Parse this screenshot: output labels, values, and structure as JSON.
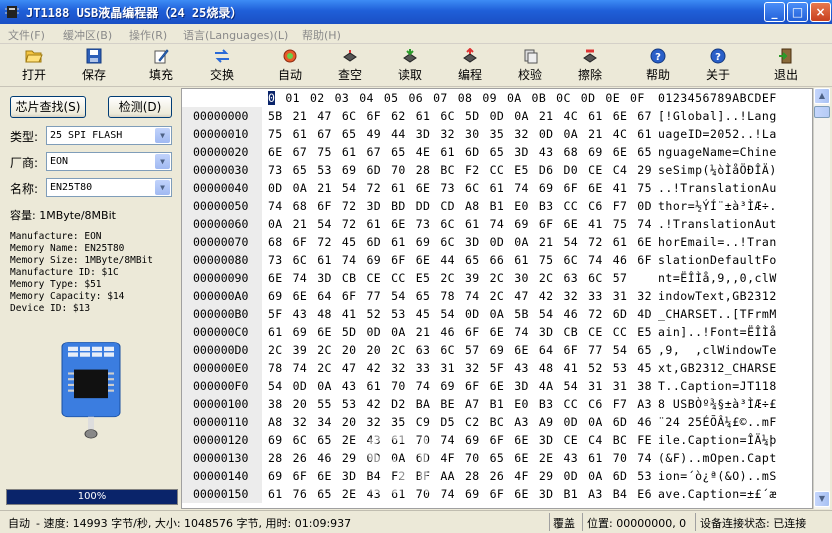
{
  "window": {
    "title": "JT1188 USB液晶编程器（24 25烧录）",
    "minimize": "_",
    "maximize": "□",
    "close": "×"
  },
  "menu": [
    "文件(F)",
    "缓冲区(B)",
    "操作(R)",
    "语言(Languages)(L)",
    "帮助(H)"
  ],
  "toolbar": {
    "open": "打开",
    "save": "保存",
    "fill": "填充",
    "swap": "交换",
    "auto": "自动",
    "check_empty": "查空",
    "read": "读取",
    "program": "编程",
    "verify": "校验",
    "erase": "擦除",
    "help": "帮助",
    "about": "关于",
    "exit": "退出"
  },
  "left": {
    "find_chip": "芯片查找(S)",
    "detect": "检测(D)",
    "type_label": "类型:",
    "type_value": "25 SPI FLASH",
    "vendor_label": "厂商:",
    "vendor_value": "EON",
    "name_label": "名称:",
    "name_value": "EN25T80",
    "capacity": "容量: 1MByte/8MBit",
    "info": [
      "Manufacture: EON",
      "Memory Name: EN25T80",
      "Memory Size: 1MByte/8MBit",
      "Manufacture ID: $1C",
      "Memory Type: $51",
      "Memory Capacity: $14",
      "Device ID: $13"
    ],
    "progress_label": "100%",
    "progress": 1.0
  },
  "hex": {
    "header_cols": "0 01 02 03 04 05 06 07 08 09 0A 0B 0C 0D 0E 0F",
    "header_ascii": "0123456789ABCDEF",
    "rows": [
      {
        "addr": "00000000",
        "bytes": "5B 21 47 6C 6F 62 61 6C 5D 0D 0A 21 4C 61 6E 67",
        "ascii": "[!Global]..!Lang"
      },
      {
        "addr": "00000010",
        "bytes": "75 61 67 65 49 44 3D 32 30 35 32 0D 0A 21 4C 61",
        "ascii": "uageID=2052..!La"
      },
      {
        "addr": "00000020",
        "bytes": "6E 67 75 61 67 65 4E 61 6D 65 3D 43 68 69 6E 65",
        "ascii": "nguageName=Chine"
      },
      {
        "addr": "00000030",
        "bytes": "73 65 53 69 6D 70 28 BC F2 CC E5 D6 D0 CE C4 29",
        "ascii": "seSimp(¼òÌåÖÐÎÄ)"
      },
      {
        "addr": "00000040",
        "bytes": "0D 0A 21 54 72 61 6E 73 6C 61 74 69 6F 6E 41 75",
        "ascii": "..!TranslationAu"
      },
      {
        "addr": "00000050",
        "bytes": "74 68 6F 72 3D BD DD CD A8 B1 E0 B3 CC C6 F7 0D",
        "ascii": "thor=½ÝÍ¨±à³ÌÆ÷."
      },
      {
        "addr": "00000060",
        "bytes": "0A 21 54 72 61 6E 73 6C 61 74 69 6F 6E 41 75 74",
        "ascii": ".!TranslationAut"
      },
      {
        "addr": "00000070",
        "bytes": "68 6F 72 45 6D 61 69 6C 3D 0D 0A 21 54 72 61 6E",
        "ascii": "horEmail=..!Tran"
      },
      {
        "addr": "00000080",
        "bytes": "73 6C 61 74 69 6F 6E 44 65 66 61 75 6C 74 46 6F",
        "ascii": "slationDefaultFo"
      },
      {
        "addr": "00000090",
        "bytes": "6E 74 3D CB CE CC E5 2C 39 2C 30 2C 63 6C 57",
        "ascii": "nt=ËÎÌå,9,,0,clW"
      },
      {
        "addr": "000000A0",
        "bytes": "69 6E 64 6F 77 54 65 78 74 2C 47 42 32 33 31 32",
        "ascii": "indowText,GB2312"
      },
      {
        "addr": "000000B0",
        "bytes": "5F 43 48 41 52 53 45 54 0D 0A 5B 54 46 72 6D 4D",
        "ascii": "_CHARSET..[TFrmM"
      },
      {
        "addr": "000000C0",
        "bytes": "61 69 6E 5D 0D 0A 21 46 6F 6E 74 3D CB CE CC E5",
        "ascii": "ain]..!Font=ËÎÌå"
      },
      {
        "addr": "000000D0",
        "bytes": "2C 39 2C 20 20 2C 63 6C 57 69 6E 64 6F 77 54 65",
        "ascii": ",9,  ,clWindowTe"
      },
      {
        "addr": "000000E0",
        "bytes": "78 74 2C 47 42 32 33 31 32 5F 43 48 41 52 53 45",
        "ascii": "xt,GB2312_CHARSE"
      },
      {
        "addr": "000000F0",
        "bytes": "54 0D 0A 43 61 70 74 69 6F 6E 3D 4A 54 31 31 38",
        "ascii": "T..Caption=JT118"
      },
      {
        "addr": "00000100",
        "bytes": "38 20 55 53 42 D2 BA BE A7 B1 E0 B3 CC C6 F7 A3",
        "ascii": "8 USBÒº¾§±à³ÌÆ÷£"
      },
      {
        "addr": "00000110",
        "bytes": "A8 32 34 20 32 35 C9 D5 C2 BC A3 A9 0D 0A 6D 46",
        "ascii": "¨24 25ÉÕÂ¼£©..mF"
      },
      {
        "addr": "00000120",
        "bytes": "69 6C 65 2E 43 61 70 74 69 6F 6E 3D CE C4 BC FE",
        "ascii": "ile.Caption=ÎÄ¼þ"
      },
      {
        "addr": "00000130",
        "bytes": "28 26 46 29 0D 0A 6D 4F 70 65 6E 2E 43 61 70 74",
        "ascii": "(&F)..mOpen.Capt"
      },
      {
        "addr": "00000140",
        "bytes": "69 6F 6E 3D B4 F2 BF AA 28 26 4F 29 0D 0A 6D 53",
        "ascii": "ion=´ò¿ª(&O)..mS"
      },
      {
        "addr": "00000150",
        "bytes": "61 76 65 2E 43 61 70 74 69 6F 6E 3D B1 A3 B4 E6",
        "ascii": "ave.Caption=±£´æ"
      }
    ]
  },
  "status": {
    "mode": "自动",
    "speed": "- 速度: 14993 字节/秒, 大小: 1048576 字节, 用时: 01:09:937",
    "overwrite": "覆盖",
    "position": "位置: 00000000, 0",
    "connection": "设备连接状态: 已连接"
  },
  "watermark": "St"
}
